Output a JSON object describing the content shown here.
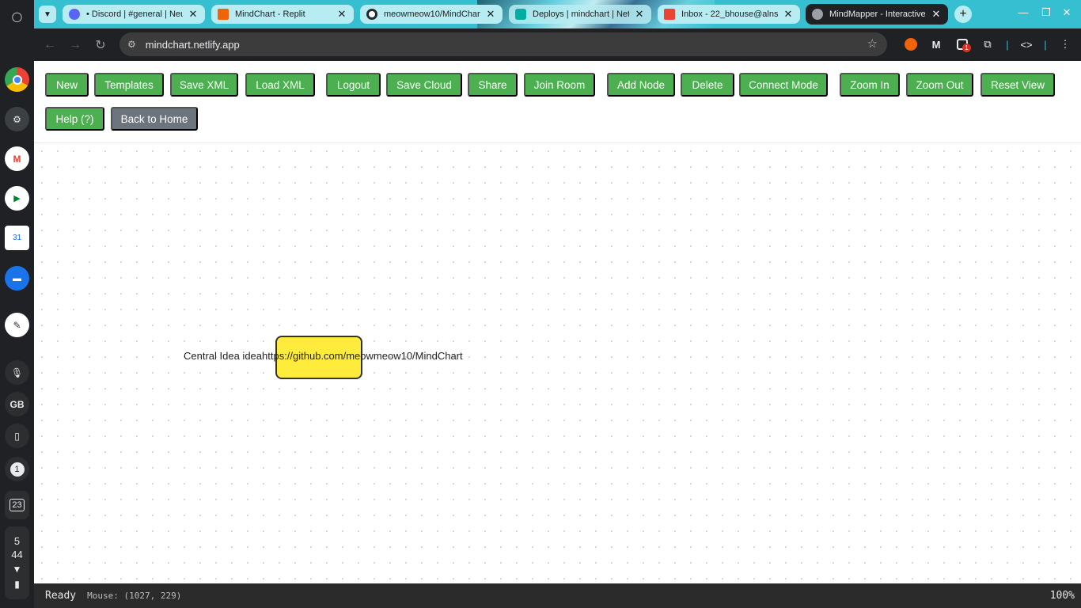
{
  "shelf": {
    "items": [
      {
        "name": "launcher-icon",
        "glyph": "◯"
      },
      {
        "name": "chrome-app-icon",
        "glyph": ""
      },
      {
        "name": "settings-app-icon",
        "glyph": "⚙"
      },
      {
        "name": "gmail-app-icon",
        "glyph": "M"
      },
      {
        "name": "meet-app-icon",
        "glyph": "▶"
      },
      {
        "name": "calendar-app-icon",
        "glyph": "31"
      },
      {
        "name": "files-app-icon",
        "glyph": "▬"
      },
      {
        "name": "notes-app-icon",
        "glyph": "✎"
      }
    ],
    "mic_glyph": "🎙",
    "user_initials": "GB",
    "phone_glyph": "▯",
    "notification_count": "1",
    "date_day": "23",
    "clock_hour": "5",
    "clock_minute": "44",
    "wifi_glyph": "▼",
    "battery_glyph": "▮"
  },
  "browser": {
    "tabs": [
      {
        "title": "• Discord | #general | Neu",
        "favicon_color": "#5865f2",
        "active": false
      },
      {
        "title": "MindChart - Replit",
        "favicon_color": "#f26207",
        "active": false
      },
      {
        "title": "meowmeow10/MindChart",
        "favicon_color": "#ffffff",
        "active": false
      },
      {
        "title": "Deploys | mindchart | Netl",
        "favicon_color": "#00ad9f",
        "active": false
      },
      {
        "title": "Inbox - 22_bhouse@alnsc",
        "favicon_color": "#ea4335",
        "active": false
      },
      {
        "title": "MindMapper - Interactive",
        "favicon_color": "#9aa0a6",
        "active": true
      }
    ],
    "tab_close_glyph": "✕",
    "tabs_dropdown_glyph": "▼",
    "new_tab_glyph": "+",
    "minimize_glyph": "—",
    "maximize_glyph": "❐",
    "close_glyph": "✕",
    "back_glyph": "←",
    "forward_glyph": "→",
    "reload_glyph": "↻",
    "site_info_glyph": "⚙",
    "bookmark_glyph": "☆",
    "url": "mindchart.netlify.app",
    "extension_badge": "1",
    "menu_glyph": "⋮"
  },
  "app": {
    "buttons": {
      "new": "New",
      "templates": "Templates",
      "save_xml": "Save XML",
      "load_xml": "Load XML",
      "logout": "Logout",
      "save_cloud": "Save Cloud",
      "share": "Share",
      "join_room": "Join Room",
      "add_node": "Add Node",
      "delete": "Delete",
      "connect_mode": "Connect Mode",
      "zoom_in": "Zoom In",
      "zoom_out": "Zoom Out",
      "reset_view": "Reset View",
      "help": "Help (?)",
      "back_home": "Back to Home"
    },
    "node": {
      "text": "Central Idea ideahttps://github.com/meowmeow10/MindChart",
      "fill": "#ffeb3b"
    },
    "status": {
      "text": "Ready",
      "mouse": "Mouse: (1027, 229)",
      "zoom": "100%"
    },
    "colors": {
      "primary_button": "#4caf50",
      "secondary_button": "#6c757d"
    }
  }
}
